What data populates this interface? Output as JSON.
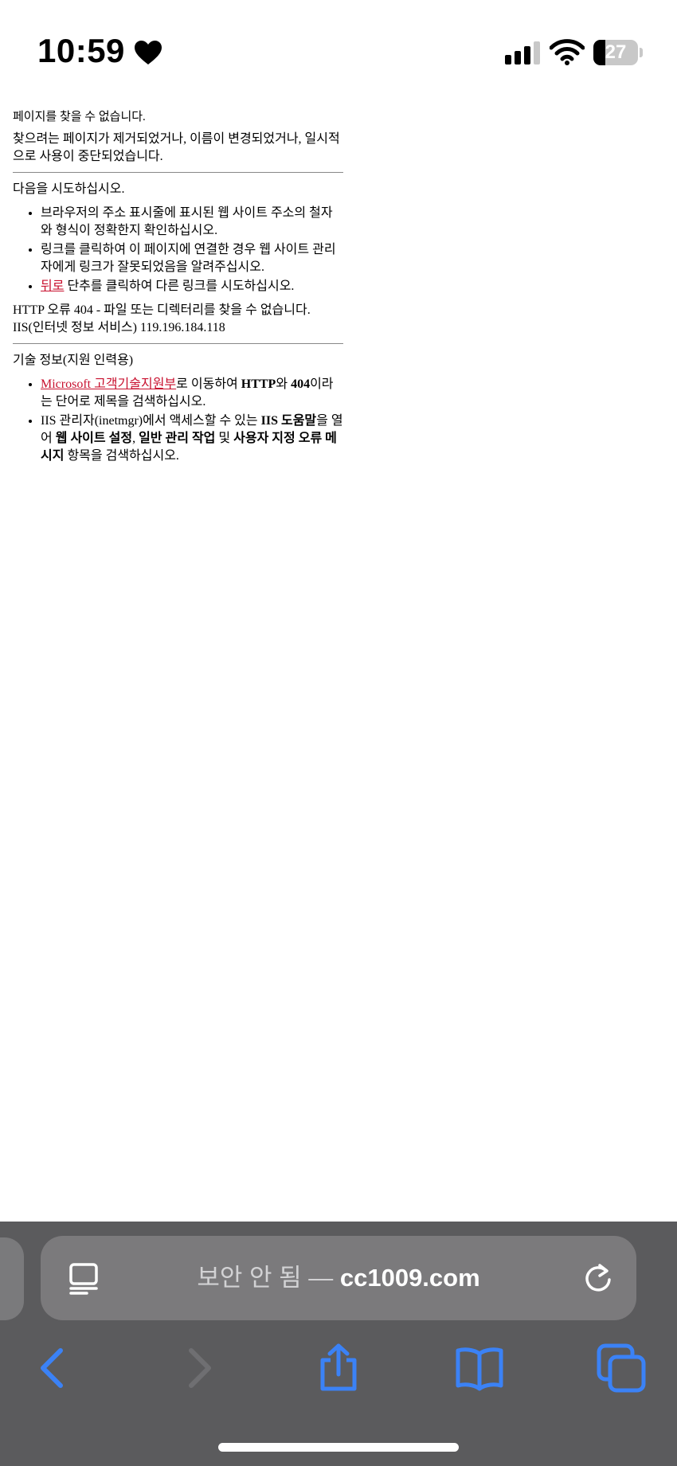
{
  "status_bar": {
    "time": "10:59",
    "battery_level": "27",
    "battery_fraction": 0.27,
    "icons": [
      "heart-icon",
      "signal-icon",
      "wifi-icon",
      "battery-icon"
    ]
  },
  "page": {
    "title": "페이지를 찾을 수 없습니다.",
    "description": "찾으려는 페이지가 제거되었거나, 이름이 변경되었거나, 일시적으로 사용이 중단되었습니다.",
    "try_heading": "다음을 시도하십시오.",
    "try_items": {
      "item1": "브라우저의 주소 표시줄에 표시된 웹 사이트 주소의 철자와 형식이 정확한지 확인하십시오.",
      "item2": "링크를 클릭하여 이 페이지에 연결한 경우 웹 사이트 관리자에게 링크가 잘못되었음을 알려주십시오.",
      "item3_link": "뒤로",
      "item3_text": " 단추를 클릭하여 다른 링크를 시도하십시오."
    },
    "error_line": "HTTP 오류 404 - 파일 또는 디렉터리를 찾을 수 없습니다.",
    "server_line": "IIS(인터넷 정보 서비스) 119.196.184.118",
    "tech_heading": "기술 정보(지원 인력용)",
    "tech_items": {
      "item1_link": "Microsoft 고객기술지원부",
      "item1_text_a": "로 이동하여 ",
      "item1_bold_a": "HTTP",
      "item1_text_b": "와 ",
      "item1_bold_b": "404",
      "item1_text_c": "이라는 단어로 제목을 검색하십시오.",
      "item2_text_a": "IIS 관리자(inetmgr)에서 액세스할 수 있는 ",
      "item2_bold_a": "IIS 도움말",
      "item2_text_b": "을 열어 ",
      "item2_bold_b": "웹 사이트 설정",
      "item2_text_c": ", ",
      "item2_bold_c": "일반 관리 작업",
      "item2_text_d": " 및 ",
      "item2_bold_d": "사용자 지정 오류 메시지",
      "item2_text_e": " 항목을 검색하십시오."
    },
    "link_color": "#c8102e"
  },
  "browser": {
    "security_label": "보안 안 됨 — ",
    "domain": "cc1009.com",
    "accent_color": "#3b82f6",
    "toolbar_icons": [
      "back-icon",
      "forward-icon",
      "share-icon",
      "bookmarks-icon",
      "tabs-icon"
    ]
  }
}
